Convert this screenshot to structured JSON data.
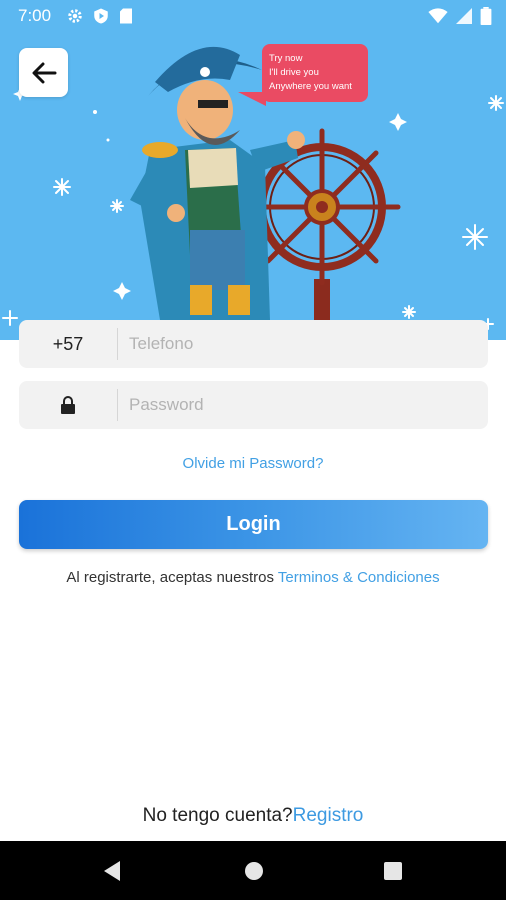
{
  "status_bar": {
    "time": "7:00",
    "left_icons": [
      "settings-icon",
      "shield-icon",
      "sd-card-icon"
    ],
    "right_icons": [
      "wifi-icon",
      "signal-icon",
      "battery-icon"
    ]
  },
  "header": {
    "back_icon": "arrow-left-icon",
    "illustration": {
      "bubble_lines": [
        "Try now",
        "I'll drive you",
        "Anywhere you want"
      ]
    }
  },
  "form": {
    "phone_prefix": "+57",
    "phone_placeholder": "Telefono",
    "password_icon": "lock-icon",
    "password_placeholder": "Password",
    "forgot_password": "Olvide mi Password?",
    "login_label": "Login",
    "terms_prefix": "Al registrarte, aceptas nuestros ",
    "terms_link": "Terminos & Condiciones"
  },
  "footer": {
    "no_account": "No tengo cuenta?",
    "register_link": "Registro"
  },
  "nav_bar": {
    "icons": [
      "back-triangle-icon",
      "home-circle-icon",
      "recents-square-icon"
    ]
  },
  "colors": {
    "hero_background": "#5cb8f1",
    "accent": "#42a0e4",
    "login_gradient_start": "#1a72d9",
    "login_gradient_end": "#65b4f2",
    "bubble": "#ea4b63"
  }
}
